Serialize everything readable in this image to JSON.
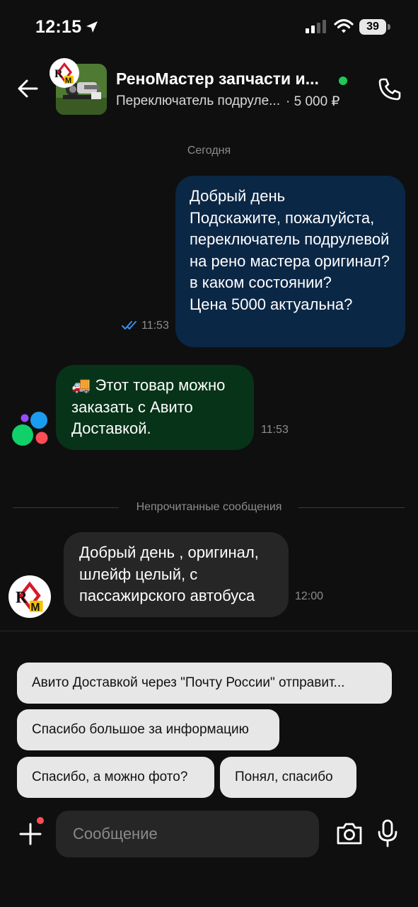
{
  "status_bar": {
    "time": "12:15",
    "battery": "39"
  },
  "header": {
    "title": "РеноМастер запчасти и...",
    "product": "Переключатель подруле...",
    "price": "· 5 000 ₽",
    "online": true
  },
  "chat": {
    "day_label": "Сегодня",
    "unread_label": "Непрочитанные сообщения",
    "messages": [
      {
        "text": "Добрый день\nПодскажите, пожалуйста, переключатель подрулевой на рено мастера оригинал? в каком состоянии?\nЦена 5000 актуальна?",
        "time": "11:53"
      },
      {
        "text": "🚚 Этот товар можно заказать с Авито Доставкой.",
        "time": "11:53"
      },
      {
        "text": "Добрый день , оригинал, шлейф целый, с пассажирского автобуса",
        "time": "12:00"
      }
    ]
  },
  "quick_replies": [
    "Авито Доставкой через \"Почту России\" отправит...",
    "Спасибо большое за информацию",
    "Спасибо, а можно фото?",
    "Понял, спасибо"
  ],
  "composer": {
    "placeholder": "Сообщение"
  },
  "colors": {
    "background": "#0f0f0f",
    "outgoing_bubble": "#0b2746",
    "delivery_bubble": "#073319",
    "incoming_bubble": "#262626",
    "online": "#1ec85a",
    "chip": "#e7e7e7"
  }
}
